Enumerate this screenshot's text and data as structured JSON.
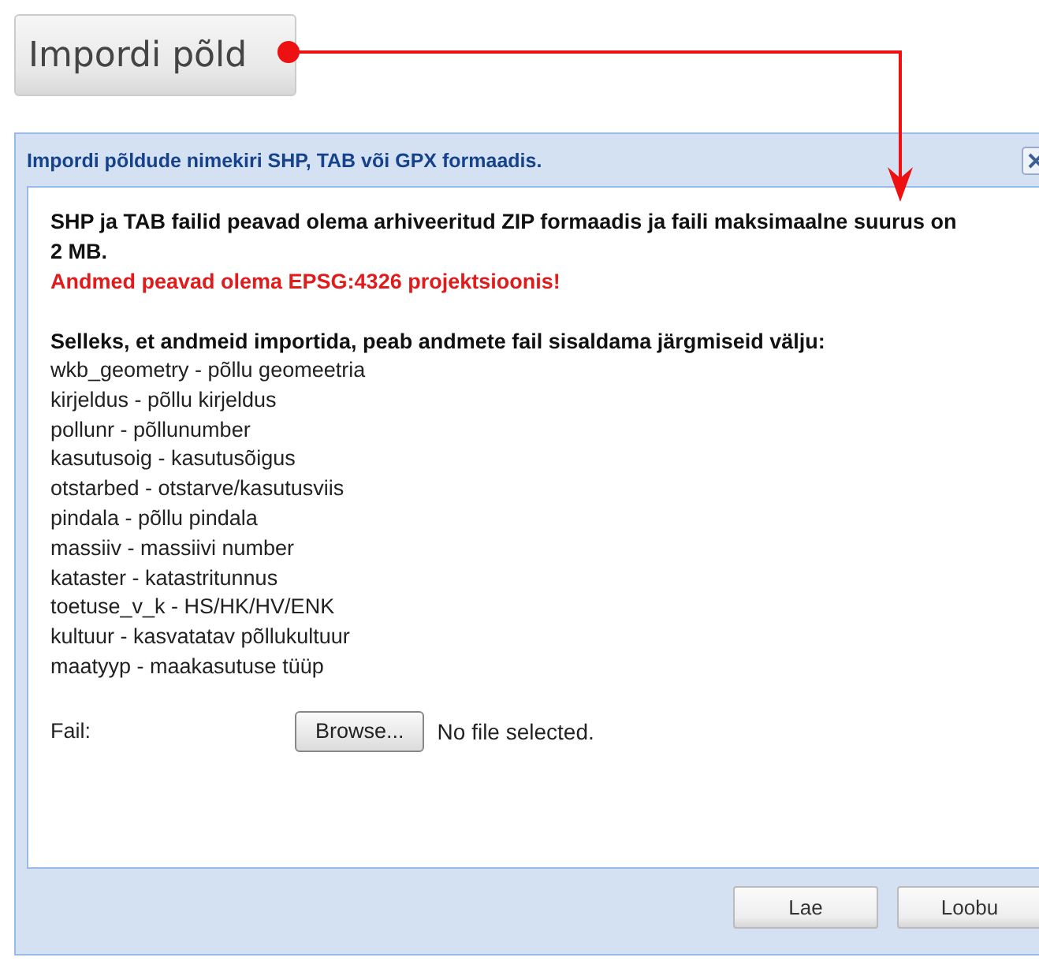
{
  "trigger_button": {
    "label": "Impordi põld"
  },
  "dialog": {
    "title": "Impordi põldude nimekiri SHP, TAB või GPX formaadis.",
    "notice": "SHP ja TAB failid peavad olema arhiveeritud ZIP formaadis ja faili maksimaalne suurus on 2 MB.",
    "warning": "Andmed peavad olema EPSG:4326 projektsioonis!",
    "fields_heading": "Selleks, et andmeid importida, peab andmete fail sisaldama järgmiseid välju:",
    "fields": [
      "wkb_geometry - põllu geomeetria",
      "kirjeldus - põllu kirjeldus",
      "pollunr - põllunumber",
      "kasutusoig - kasutusõigus",
      "otstarbed - otstarve/kasutusviis",
      "pindala - põllu pindala",
      "massiiv - massiivi number",
      "kataster - katastritunnus",
      "toetuse_v_k - HS/HK/HV/ENK",
      "kultuur - kasvatatav põllukultuur",
      "maatyyp - maakasutuse tüüp"
    ],
    "file_label": "Fail:",
    "browse_button": "Browse...",
    "file_status": "No file selected.",
    "buttons": [
      "Lae",
      "Loobu"
    ]
  }
}
